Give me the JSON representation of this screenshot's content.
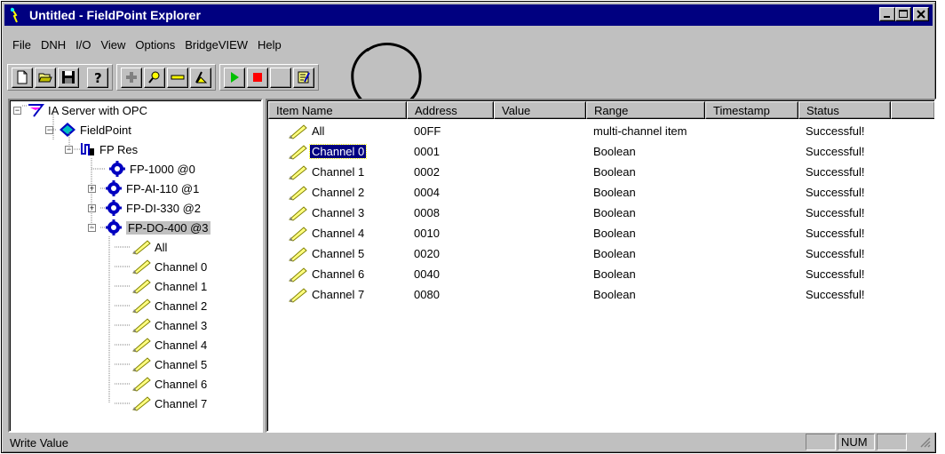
{
  "window": {
    "title": "Untitled - FieldPoint Explorer",
    "controls": [
      "minimize",
      "maximize",
      "close"
    ]
  },
  "menu": {
    "items": [
      {
        "label": "File"
      },
      {
        "label": "DNH"
      },
      {
        "label": "I/O"
      },
      {
        "label": "View"
      },
      {
        "label": "Options"
      },
      {
        "label": "BridgeVIEW"
      },
      {
        "label": "Help"
      }
    ]
  },
  "toolbar": {
    "groups": [
      [
        "new-document-icon",
        "open-folder-icon",
        "save-disk-icon",
        "help-icon"
      ],
      [
        "add-icon",
        "find-icon",
        "remove-icon",
        "dnh-icon"
      ],
      [
        "start-green-icon",
        "stop-red-icon",
        "blank-icon",
        "write-value-icon"
      ]
    ]
  },
  "tree": {
    "items": [
      {
        "label": "IA Server with OPC",
        "icon": "network-icon",
        "level": 0,
        "expander": "minus"
      },
      {
        "label": "FieldPoint",
        "icon": "fieldpoint-diamond-icon",
        "level": 1,
        "expander": "minus"
      },
      {
        "label": "FP Res",
        "icon": "resource-icon",
        "level": 2,
        "expander": "minus"
      },
      {
        "label": "FP-1000 @0",
        "icon": "module-gear-icon",
        "level": 3,
        "expander": "none"
      },
      {
        "label": "FP-AI-110 @1",
        "icon": "module-gear-icon",
        "level": 3,
        "expander": "plus"
      },
      {
        "label": "FP-DI-330 @2",
        "icon": "module-gear-icon",
        "level": 3,
        "expander": "plus"
      },
      {
        "label": "FP-DO-400 @3",
        "icon": "module-gear-icon",
        "level": 3,
        "expander": "minus",
        "selected": true
      },
      {
        "label": "All",
        "icon": "channel-pencil-icon",
        "level": 4,
        "expander": "none"
      },
      {
        "label": "Channel 0",
        "icon": "channel-pencil-icon",
        "level": 4,
        "expander": "none"
      },
      {
        "label": "Channel 1",
        "icon": "channel-pencil-icon",
        "level": 4,
        "expander": "none"
      },
      {
        "label": "Channel 2",
        "icon": "channel-pencil-icon",
        "level": 4,
        "expander": "none"
      },
      {
        "label": "Channel 3",
        "icon": "channel-pencil-icon",
        "level": 4,
        "expander": "none"
      },
      {
        "label": "Channel 4",
        "icon": "channel-pencil-icon",
        "level": 4,
        "expander": "none"
      },
      {
        "label": "Channel 5",
        "icon": "channel-pencil-icon",
        "level": 4,
        "expander": "none"
      },
      {
        "label": "Channel 6",
        "icon": "channel-pencil-icon",
        "level": 4,
        "expander": "none"
      },
      {
        "label": "Channel 7",
        "icon": "channel-pencil-icon",
        "level": 4,
        "expander": "none"
      }
    ]
  },
  "list": {
    "columns": [
      "Item Name",
      "Address",
      "Value",
      "Range",
      "Timestamp",
      "Status"
    ],
    "rows": [
      {
        "name": "All",
        "address": "00FF",
        "value": "",
        "range": "multi-channel item",
        "timestamp": "",
        "status": "Successful!"
      },
      {
        "name": "Channel 0",
        "address": "0001",
        "value": "",
        "range": "Boolean",
        "timestamp": "",
        "status": "Successful!",
        "selected": true
      },
      {
        "name": "Channel 1",
        "address": "0002",
        "value": "",
        "range": "Boolean",
        "timestamp": "",
        "status": "Successful!"
      },
      {
        "name": "Channel 2",
        "address": "0004",
        "value": "",
        "range": "Boolean",
        "timestamp": "",
        "status": "Successful!"
      },
      {
        "name": "Channel 3",
        "address": "0008",
        "value": "",
        "range": "Boolean",
        "timestamp": "",
        "status": "Successful!"
      },
      {
        "name": "Channel 4",
        "address": "0010",
        "value": "",
        "range": "Boolean",
        "timestamp": "",
        "status": "Successful!"
      },
      {
        "name": "Channel 5",
        "address": "0020",
        "value": "",
        "range": "Boolean",
        "timestamp": "",
        "status": "Successful!"
      },
      {
        "name": "Channel 6",
        "address": "0040",
        "value": "",
        "range": "Boolean",
        "timestamp": "",
        "status": "Successful!"
      },
      {
        "name": "Channel 7",
        "address": "0080",
        "value": "",
        "range": "Boolean",
        "timestamp": "",
        "status": "Successful!"
      }
    ]
  },
  "statusbar": {
    "text": "Write Value",
    "indicator": "NUM"
  },
  "colors": {
    "title_bar": "#000080",
    "face": "#c0c0c0",
    "selection": "#000080"
  }
}
